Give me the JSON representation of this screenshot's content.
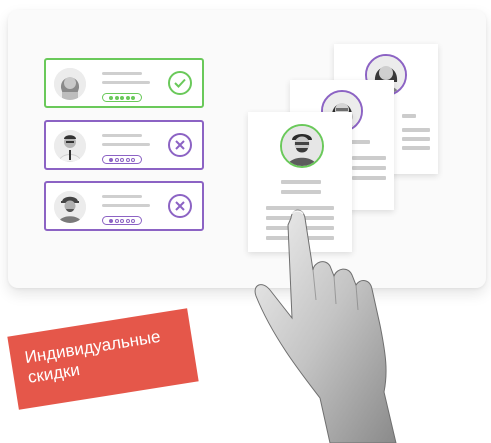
{
  "badge": {
    "line1": "Индивидуальные",
    "line2": "скидки"
  },
  "colors": {
    "accent_green": "#6ac95a",
    "accent_purple": "#8c63c4",
    "badge": "#e5574a"
  },
  "candidates": [
    {
      "status": "approved",
      "status_icon": "check-icon",
      "rating": 5
    },
    {
      "status": "rejected",
      "status_icon": "cross-icon",
      "rating": 1
    },
    {
      "status": "rejected",
      "status_icon": "cross-icon",
      "rating": 1
    }
  ],
  "resumes": [
    {
      "highlighted": true
    },
    {
      "highlighted": false
    },
    {
      "highlighted": false
    }
  ]
}
